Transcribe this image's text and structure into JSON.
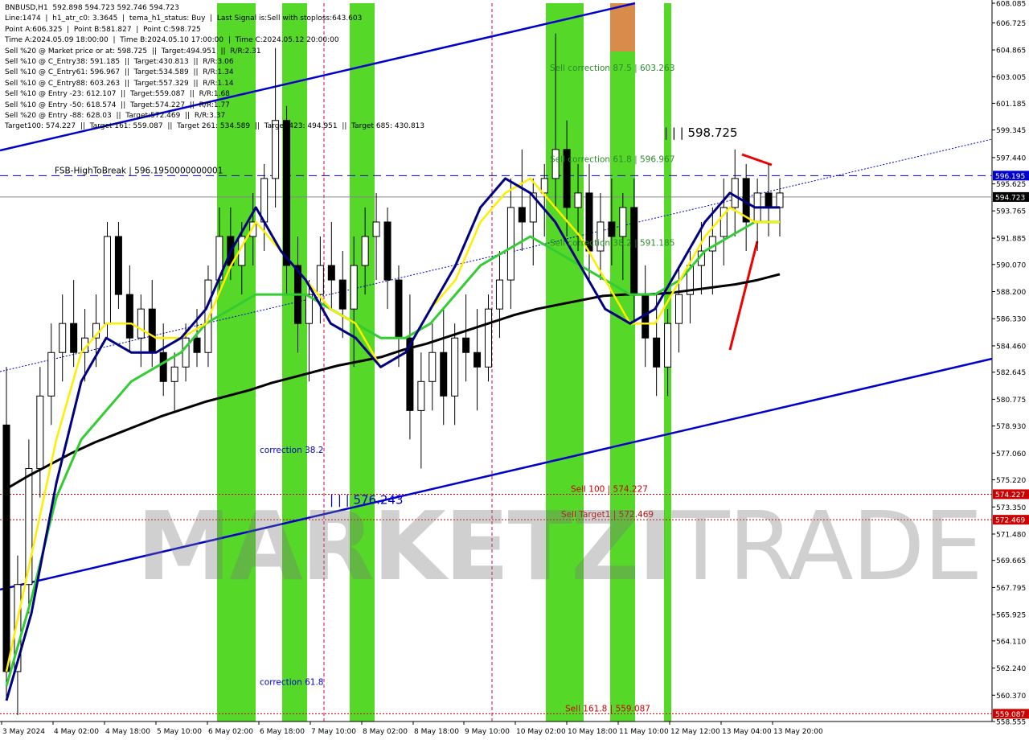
{
  "header": {
    "lines": [
      "BNBUSD,H1  592.898 594.723 592.746 594.723",
      "Line:1474  |  h1_atr_c0: 3.3645  |  tema_h1_status: Buy  |  Last Signal is:Sell with stoploss:643.603",
      "Point A:606.325  |  Point B:581.827  |  Point C:598.725",
      "Time A:2024.05.09 18:00:00  |  Time B:2024.05.10 17:00:00  |  Time C:2024.05.12 20:00:00",
      "Sell %20 @ Market price or at: 598.725  ||  Target:494.951  ||  R/R:2.31",
      "Sell %10 @ C_Entry38: 591.185  ||  Target:430.813  ||  R/R:3.06",
      "Sell %10 @ C_Entry61: 596.967  ||  Target:534.589  ||  R/R:1.34",
      "Sell %10 @ C_Entry88: 603.263  ||  Target:557.329  ||  R/R:1.14",
      "Sell %10 @ Entry -23: 612.107  ||  Target:559.087  ||  R/R:1.68",
      "Sell %10 @ Entry -50: 618.574  ||  Target:574.227  ||  R/R:1.77",
      "Sell %20 @ Entry -88: 628.03  ||  Target:572.469  ||  R/R:3.37",
      "Target100: 574.227  ||  Target 161: 559.087  ||  Target 261: 534.589  ||  Target 423: 494.951  ||  Target 685: 430.813"
    ]
  },
  "watermark": {
    "bold": "MARKETZI",
    "light": "TRADE"
  },
  "chart_data": {
    "type": "candlestick",
    "symbol": "BNBUSD",
    "timeframe": "H1",
    "ylim": [
      558.555,
      608.085
    ],
    "y_ticks": [
      "608.085",
      "606.725",
      "604.865",
      "603.005",
      "601.185",
      "599.345",
      "597.440",
      "595.625",
      "593.765",
      "591.885",
      "590.070",
      "588.200",
      "586.330",
      "584.460",
      "582.645",
      "580.775",
      "578.930",
      "577.060",
      "575.220",
      "573.350",
      "571.480",
      "569.665",
      "567.795",
      "565.925",
      "564.110",
      "562.240",
      "560.370",
      "558.555"
    ],
    "x_labels": [
      "3 May 2024",
      "4 May 02:00",
      "4 May 18:00",
      "5 May 10:00",
      "6 May 02:00",
      "6 May 18:00",
      "7 May 10:00",
      "8 May 02:00",
      "8 May 18:00",
      "9 May 10:00",
      "10 May 02:00",
      "10 May 18:00",
      "11 May 10:00",
      "12 May 12:00",
      "13 May 04:00",
      "13 May 20:00"
    ],
    "price_tags": [
      {
        "value": 596.195,
        "label": "596.195",
        "color": "#0000cc",
        "text_color": "#ffffff"
      },
      {
        "value": 594.723,
        "label": "594.723",
        "color": "#000000",
        "text_color": "#ffffff"
      },
      {
        "value": 574.227,
        "label": "574.227",
        "color": "#cc0000",
        "text_color": "#ffffff"
      },
      {
        "value": 572.469,
        "label": "572.469",
        "color": "#cc0000",
        "text_color": "#ffffff"
      },
      {
        "value": 559.087,
        "label": "559.087",
        "color": "#cc0000",
        "text_color": "#ffffff"
      }
    ],
    "annotations": [
      {
        "text": "FSB-HighToBreak  |  596.1950000000001",
        "y": 596.195,
        "color": "#000000"
      },
      {
        "text": "Sell correction 87.5 | 603.263",
        "y": 603.263,
        "color": "#2a8a2a"
      },
      {
        "text": "| | | 598.725",
        "y": 598.725,
        "color": "#000000"
      },
      {
        "text": "Sell correction 61.8 | 596.967",
        "y": 596.967,
        "color": "#2a8a2a"
      },
      {
        "text": "Sell correction 38.2 | 591.185",
        "y": 591.185,
        "color": "#2a8a2a"
      },
      {
        "text": "correction 38.2",
        "y": 576.9,
        "color": "#0000cc"
      },
      {
        "text": "| | | 576.243",
        "y": 573.4,
        "color": "#0000cc"
      },
      {
        "text": "Sell 100 | 574.227",
        "y": 574.227,
        "color": "#cc0000"
      },
      {
        "text": "Sell Target1 | 572.469",
        "y": 572.469,
        "color": "#cc0000"
      },
      {
        "text": "correction 61.8",
        "y": 560.9,
        "color": "#0000cc"
      },
      {
        "text": "Sell 161.8 | 559.087",
        "y": 559.087,
        "color": "#cc0000"
      }
    ],
    "levels": [
      {
        "value": 596.195,
        "color": "#0000cc",
        "style": "dashed"
      },
      {
        "value": 594.723,
        "color": "#888888",
        "style": "solid"
      },
      {
        "value": 574.227,
        "color": "#cc0000",
        "style": "dotted"
      },
      {
        "value": 572.469,
        "color": "#cc0000",
        "style": "dotted"
      },
      {
        "value": 559.087,
        "color": "#cc0000",
        "style": "dotted"
      }
    ],
    "candles": [
      [
        579,
        583,
        560,
        562
      ],
      [
        562,
        570,
        559,
        568
      ],
      [
        568,
        578,
        566,
        576
      ],
      [
        576,
        583,
        574,
        581
      ],
      [
        581,
        586,
        579,
        584
      ],
      [
        584,
        588,
        582,
        586
      ],
      [
        586,
        589,
        583,
        584
      ],
      [
        584,
        587,
        582,
        585
      ],
      [
        585,
        588,
        583,
        586
      ],
      [
        586,
        593,
        585,
        592
      ],
      [
        592,
        593,
        587,
        588
      ],
      [
        588,
        590,
        584,
        585
      ],
      [
        585,
        588,
        583,
        587
      ],
      [
        587,
        589,
        583,
        584
      ],
      [
        584,
        586,
        581,
        582
      ],
      [
        582,
        584,
        580,
        583
      ],
      [
        583,
        586,
        582,
        585
      ],
      [
        585,
        587,
        583,
        584
      ],
      [
        584,
        590,
        583,
        589
      ],
      [
        589,
        594,
        588,
        592
      ],
      [
        592,
        594,
        589,
        590
      ],
      [
        590,
        593,
        588,
        592
      ],
      [
        592,
        595,
        590,
        593
      ],
      [
        593,
        597,
        591,
        596
      ],
      [
        596,
        605,
        594,
        600
      ],
      [
        600,
        601,
        588,
        590
      ],
      [
        590,
        592,
        584,
        586
      ],
      [
        586,
        589,
        582,
        588
      ],
      [
        588,
        592,
        586,
        590
      ],
      [
        590,
        593,
        587,
        589
      ],
      [
        589,
        591,
        585,
        587
      ],
      [
        587,
        592,
        583,
        590
      ],
      [
        590,
        594,
        588,
        592
      ],
      [
        592,
        595,
        589,
        593
      ],
      [
        593,
        594,
        587,
        589
      ],
      [
        589,
        590,
        583,
        585
      ],
      [
        585,
        588,
        578,
        580
      ],
      [
        580,
        584,
        576,
        582
      ],
      [
        582,
        586,
        580,
        584
      ],
      [
        584,
        587,
        579,
        581
      ],
      [
        581,
        586,
        579,
        585
      ],
      [
        585,
        588,
        582,
        584
      ],
      [
        584,
        587,
        580,
        583
      ],
      [
        583,
        588,
        582,
        587
      ],
      [
        587,
        591,
        585,
        589
      ],
      [
        589,
        596,
        587,
        594
      ],
      [
        594,
        598,
        591,
        593
      ],
      [
        593,
        596,
        590,
        595
      ],
      [
        595,
        597,
        592,
        596
      ],
      [
        596,
        606,
        594,
        598
      ],
      [
        598,
        600,
        592,
        594
      ],
      [
        594,
        597,
        591,
        595
      ],
      [
        595,
        597,
        589,
        591
      ],
      [
        591,
        595,
        589,
        593
      ],
      [
        593,
        596,
        590,
        592
      ],
      [
        592,
        595,
        589,
        594
      ],
      [
        594,
        596,
        586,
        588
      ],
      [
        588,
        590,
        583,
        585
      ],
      [
        585,
        588,
        581,
        583
      ],
      [
        583,
        587,
        581,
        586
      ],
      [
        586,
        590,
        584,
        588
      ],
      [
        588,
        591,
        586,
        590
      ],
      [
        590,
        593,
        588,
        591
      ],
      [
        591,
        594,
        588,
        592
      ],
      [
        592,
        596,
        590,
        594
      ],
      [
        594,
        598,
        592,
        596
      ],
      [
        596,
        597,
        591,
        593
      ],
      [
        593,
        596,
        591,
        595
      ],
      [
        595,
        597,
        592,
        594
      ],
      [
        594,
        596,
        592,
        595
      ]
    ],
    "ema_black": [
      574.6,
      575.5,
      576.3,
      577.1,
      577.8,
      578.4,
      579.0,
      579.6,
      580.1,
      580.6,
      581.0,
      581.4,
      581.9,
      582.3,
      582.7,
      583.1,
      583.4,
      583.7,
      584.2,
      584.6,
      585.1,
      585.6,
      586.1,
      586.6,
      587.0,
      587.3,
      587.6,
      587.9,
      588.0,
      588.0,
      588.1,
      588.3,
      588.5,
      588.7,
      589.0,
      589.4
    ],
    "ema_green": [
      561,
      567,
      574,
      578,
      580,
      582,
      583,
      584,
      586,
      587,
      588,
      588,
      588,
      587,
      586,
      585,
      585,
      586,
      588,
      590,
      591,
      592,
      591,
      590,
      589,
      588,
      588,
      589,
      591,
      592,
      593,
      593
    ],
    "ema_yellow": [
      562,
      570,
      578,
      584,
      586,
      586,
      585,
      585,
      586,
      590,
      593,
      591,
      589,
      587,
      586,
      583,
      584,
      587,
      589,
      593,
      595,
      596,
      594,
      592,
      589,
      586,
      586,
      589,
      592,
      594,
      593,
      593
    ],
    "ema_navy": [
      560,
      566,
      575,
      582,
      585,
      584,
      584,
      585,
      587,
      591,
      594,
      591,
      589,
      586,
      585,
      583,
      584,
      587,
      590,
      594,
      596,
      595,
      593,
      590,
      587,
      586,
      587,
      590,
      593,
      595,
      594,
      594
    ]
  }
}
